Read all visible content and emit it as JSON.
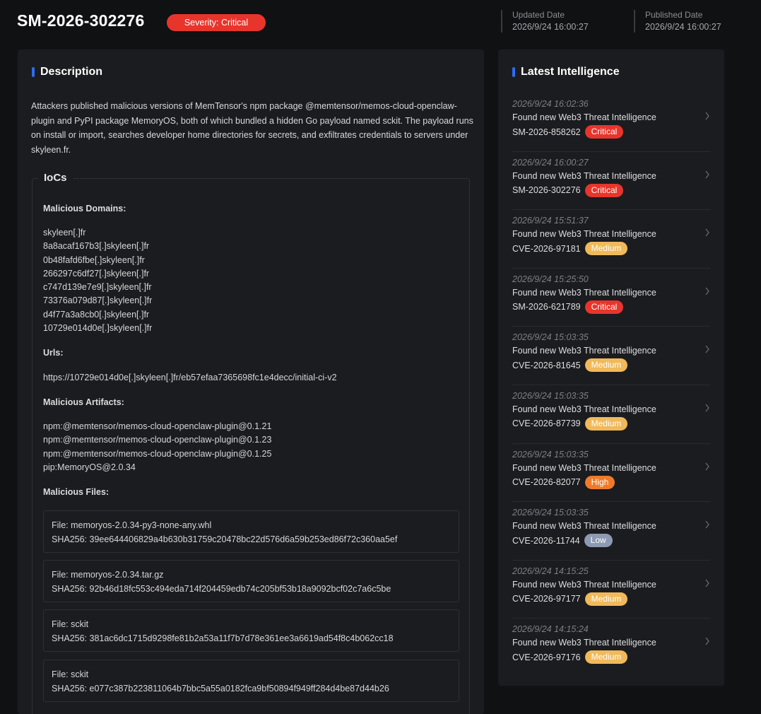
{
  "header": {
    "id": "SM-2026-302276",
    "severity": "Severity: Critical",
    "updated_label": "Updated Date",
    "updated_value": "2026/9/24 16:00:27",
    "published_label": "Published Date",
    "published_value": "2026/9/24 16:00:27"
  },
  "description": {
    "title": "Description",
    "text": "Attackers published malicious versions of MemTensor's npm package @memtensor/memos-cloud-openclaw-plugin and PyPI package MemoryOS, both of which bundled a hidden Go payload named sckit. The payload runs on install or import, searches developer home directories for secrets, and exfiltrates credentials to servers under skyleen.fr."
  },
  "iocs": {
    "title": "IoCs",
    "domains_heading": "Malicious Domains:",
    "domains": [
      "skyleen[.]fr",
      "8a8acaf167b3[.]skyleen[.]fr",
      "0b48fafd6fbe[.]skyleen[.]fr",
      "266297c6df27[.]skyleen[.]fr",
      "c747d139e7e9[.]skyleen[.]fr",
      "73376a079d87[.]skyleen[.]fr",
      "d4f77a3a8cb0[.]skyleen[.]fr",
      "10729e014d0e[.]skyleen[.]fr"
    ],
    "urls_heading": "Urls:",
    "urls": [
      "https://10729e014d0e[.]skyleen[.]fr/eb57efaa7365698fc1e4decc/initial-ci-v2"
    ],
    "artifacts_heading": "Malicious Artifacts:",
    "artifacts": [
      "npm:@memtensor/memos-cloud-openclaw-plugin@0.1.21",
      "npm:@memtensor/memos-cloud-openclaw-plugin@0.1.23",
      "npm:@memtensor/memos-cloud-openclaw-plugin@0.1.25",
      "pip:MemoryOS@2.0.34"
    ],
    "files_heading": "Malicious Files:",
    "files": [
      {
        "file": "File: memoryos-2.0.34-py3-none-any.whl",
        "sha": "SHA256: 39ee644406829a4b630b31759c20478bc22d576d6a59b253ed86f72c360aa5ef"
      },
      {
        "file": "File: memoryos-2.0.34.tar.gz",
        "sha": "SHA256: 92b46d18fc553c494eda714f204459edb74c205bf53b18a9092bcf02c7a6c5be"
      },
      {
        "file": "File: sckit",
        "sha": "SHA256: 381ac6dc1715d9298fe81b2a53a11f7b7d78e361ee3a6619ad54f8c4b062cc18"
      },
      {
        "file": "File: sckit",
        "sha": "SHA256: e077c387b223811064b7bbc5a55a0182fca9bf50894f949ff284d4be87d44b26"
      }
    ]
  },
  "intel": {
    "title": "Latest Intelligence",
    "items": [
      {
        "time": "2026/9/24 16:02:36",
        "text": "Found new Web3 Threat Intelligence",
        "id": "SM-2026-858262",
        "level": "Critical"
      },
      {
        "time": "2026/9/24 16:00:27",
        "text": "Found new Web3 Threat Intelligence",
        "id": "SM-2026-302276",
        "level": "Critical"
      },
      {
        "time": "2026/9/24 15:51:37",
        "text": "Found new Web3 Threat Intelligence",
        "id": "CVE-2026-97181",
        "level": "Medium"
      },
      {
        "time": "2026/9/24 15:25:50",
        "text": "Found new Web3 Threat Intelligence",
        "id": "SM-2026-621789",
        "level": "Critical"
      },
      {
        "time": "2026/9/24 15:03:35",
        "text": "Found new Web3 Threat Intelligence",
        "id": "CVE-2026-81645",
        "level": "Medium"
      },
      {
        "time": "2026/9/24 15:03:35",
        "text": "Found new Web3 Threat Intelligence",
        "id": "CVE-2026-87739",
        "level": "Medium"
      },
      {
        "time": "2026/9/24 15:03:35",
        "text": "Found new Web3 Threat Intelligence",
        "id": "CVE-2026-82077",
        "level": "High"
      },
      {
        "time": "2026/9/24 15:03:35",
        "text": "Found new Web3 Threat Intelligence",
        "id": "CVE-2026-11744",
        "level": "Low"
      },
      {
        "time": "2026/9/24 14:15:25",
        "text": "Found new Web3 Threat Intelligence",
        "id": "CVE-2026-97177",
        "level": "Medium"
      },
      {
        "time": "2026/9/24 14:15:24",
        "text": "Found new Web3 Threat Intelligence",
        "id": "CVE-2026-97176",
        "level": "Medium"
      }
    ]
  },
  "colors": {
    "Critical": "#e8352c",
    "High": "#ef7b2a",
    "Medium": "#f0b95a",
    "Low": "#8d9ab3",
    "accent": "#2f6bf2"
  },
  "icons": {
    "intel_chevron": "chevron-right-icon"
  }
}
